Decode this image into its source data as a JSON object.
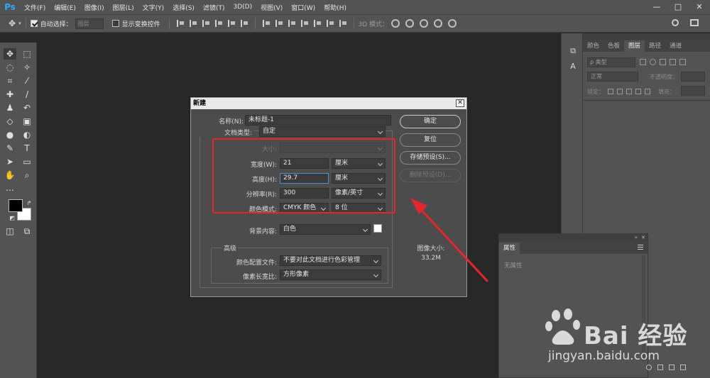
{
  "app": {
    "logo": "Ps",
    "menu": [
      "文件(F)",
      "编辑(E)",
      "图像(I)",
      "图层(L)",
      "文字(Y)",
      "选择(S)",
      "滤镜(T)",
      "3D(D)",
      "视图(V)",
      "窗口(W)",
      "帮助(H)"
    ],
    "window_controls": [
      "—",
      "□",
      "✕"
    ]
  },
  "options_bar": {
    "auto_select_label": "自动选择：",
    "auto_select_target": "图层",
    "show_transform_label": "显示变换控件",
    "mode_3d_label": "3D 模式："
  },
  "layers_panel": {
    "tabs": [
      "颜色",
      "色板",
      "图层",
      "路径",
      "通道"
    ],
    "active_tab": "图层",
    "search_placeholder": "ρ 类型",
    "blend_mode": "正常",
    "opacity_label": "不透明度：",
    "lock_label": "锁定：",
    "fill_label": "填充："
  },
  "properties_panel": {
    "tab": "属性",
    "empty_text": "无属性"
  },
  "new_dialog": {
    "title": "新建",
    "close": "✕",
    "name_label": "名称(N):",
    "name_value": "未标题-1",
    "doc_type_label": "文档类型:",
    "doc_type_value": "自定",
    "size_label": "大小:",
    "width_label": "宽度(W):",
    "width_value": "21",
    "width_unit": "厘米",
    "height_label": "高度(H):",
    "height_value": "29.7",
    "height_unit": "厘米",
    "resolution_label": "分辨率(R):",
    "resolution_value": "300",
    "resolution_unit": "像素/英寸",
    "color_mode_label": "颜色模式:",
    "color_mode_value": "CMYK 颜色",
    "bit_depth": "8 位",
    "bg_label": "背景内容:",
    "bg_value": "白色",
    "advanced_label": "高级",
    "profile_label": "颜色配置文件:",
    "profile_value": "不要对此文档进行色彩管理",
    "aspect_label": "像素长宽比:",
    "aspect_value": "方形像素",
    "buttons": {
      "ok": "确定",
      "reset": "复位",
      "save_preset": "存储预设(S)...",
      "delete_preset": "删除预设(D)..."
    },
    "image_size_label": "图像大小:",
    "image_size_value": "33.2M"
  },
  "annotation": {
    "color": "#e5272b"
  },
  "watermark": {
    "brand": "Bai  经验",
    "url": "jingyan.baidu.com"
  },
  "colors": {
    "foreground": "#000000",
    "background": "#ffffff",
    "ps_blue": "#31a8ff"
  }
}
